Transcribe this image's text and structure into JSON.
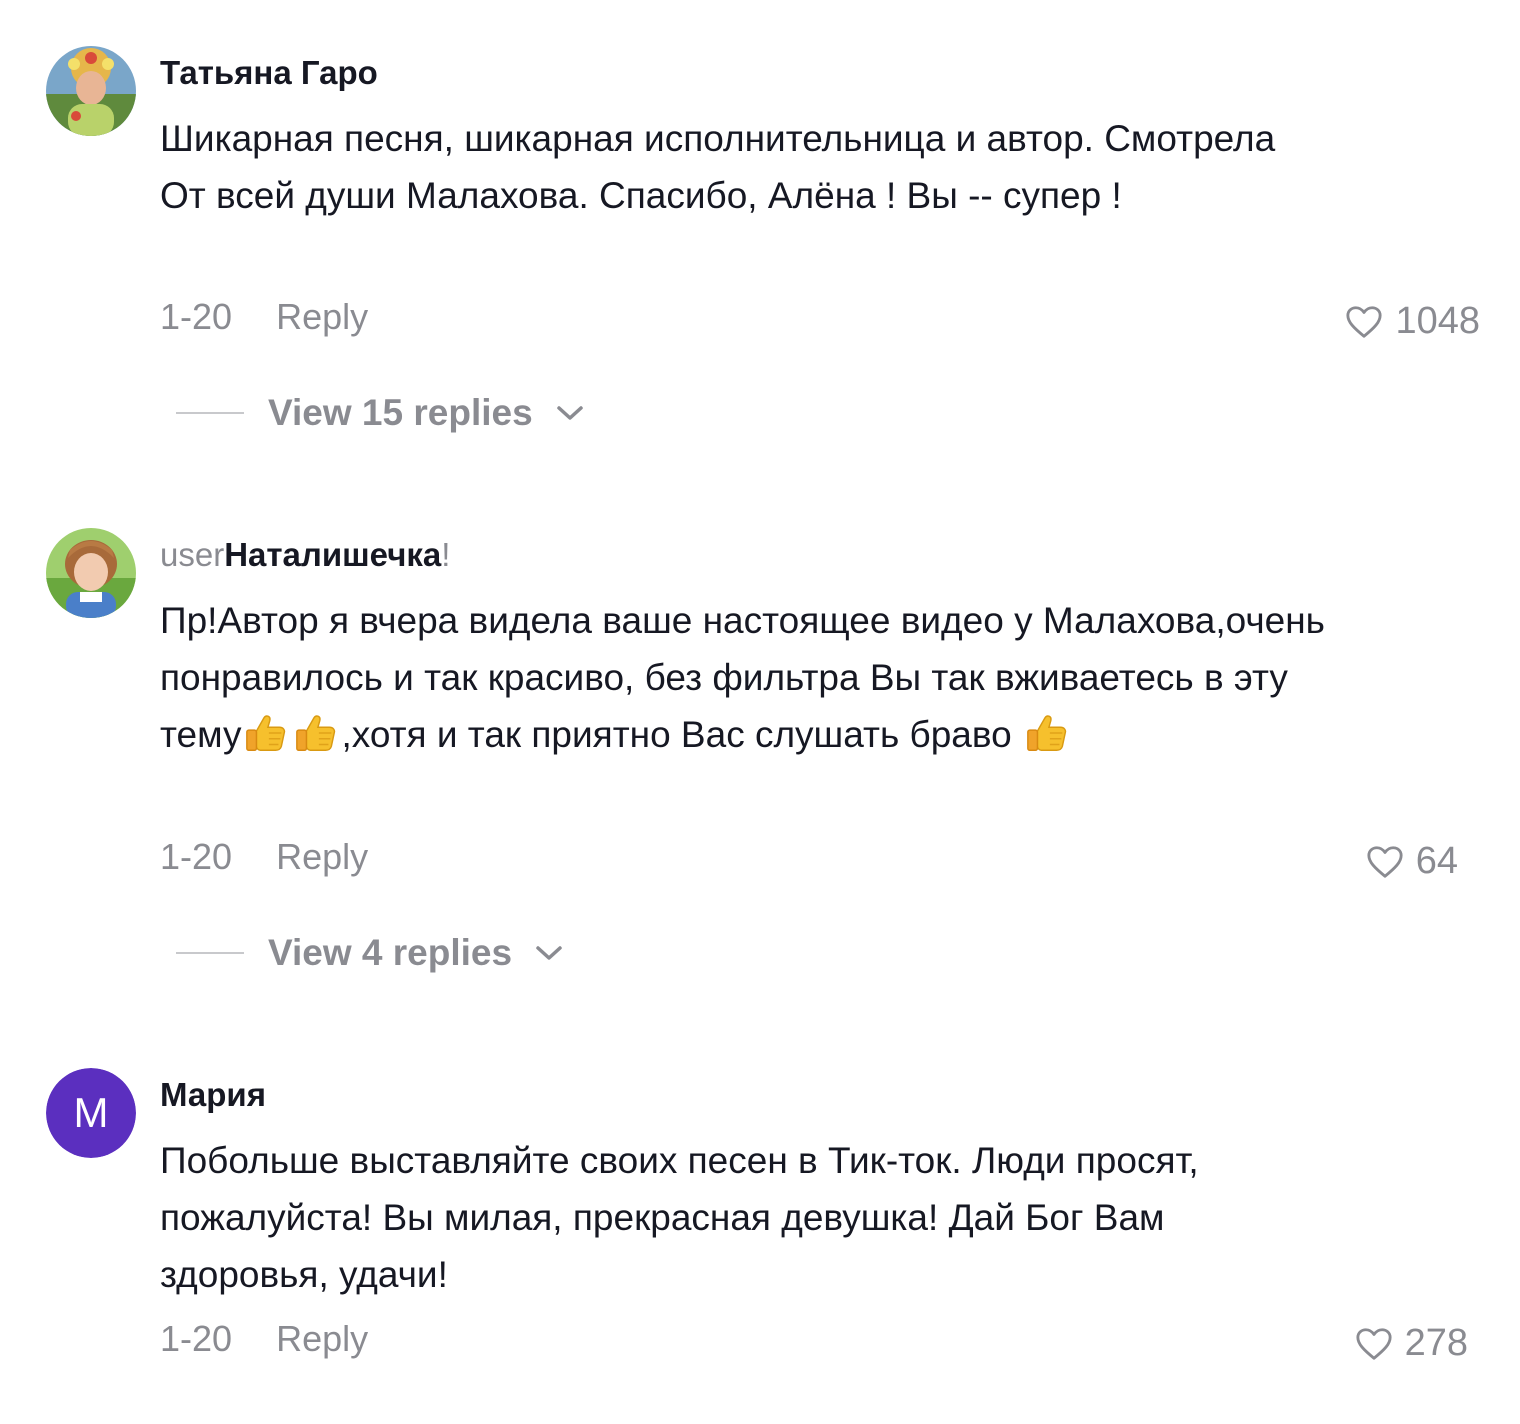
{
  "comments": [
    {
      "username": "Татьяна Гаро",
      "text": "Шикарная песня, шикарная исполнительница и автор. Смотрела От всей души Малахова. Спасибо, Алёна ! Вы -- супер !",
      "date": "1-20",
      "reply_label": "Reply",
      "likes": "1048",
      "view_replies": "View 15 replies"
    },
    {
      "username_prefix": "user",
      "username": "Наталишечка",
      "username_suffix": "!",
      "text_part1": "Пр!Автор я вчера видела ваше настоящее видео у Малахова,очень понравилось и так красиво, без фильтра Вы так вживаетесь в эту тему",
      "text_part2": ",хотя и так приятно Вас слушать браво ",
      "date": "1-20",
      "reply_label": "Reply",
      "likes": "64",
      "view_replies": "View 4 replies"
    },
    {
      "avatar_letter": "M",
      "avatar_color": "#5b2fbf",
      "username": "Мария",
      "text": "Побольше выставляйте своих песен в Тик-ток. Люди просят, пожалуйста! Вы милая, прекрасная девушка! Дай Бог Вам здоровья, удачи!",
      "date": "1-20",
      "reply_label": "Reply",
      "likes": "278"
    }
  ],
  "icons": {
    "like": "heart-outline-icon",
    "expand": "chevron-down-icon",
    "emoji": "thumbs-up-emoji"
  }
}
